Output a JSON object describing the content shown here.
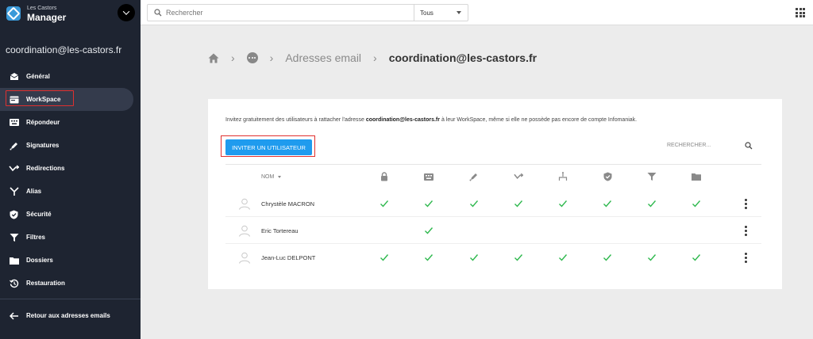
{
  "brand": {
    "small": "Les Castors",
    "name": "Manager"
  },
  "account": "coordination@les-castors.fr",
  "sidebar": {
    "items": [
      {
        "label": "Général",
        "icon": "envelope-open-icon"
      },
      {
        "label": "WorkSpace",
        "icon": "workspace-icon",
        "active": true
      },
      {
        "label": "Répondeur",
        "icon": "keyboard-icon"
      },
      {
        "label": "Signatures",
        "icon": "pen-icon"
      },
      {
        "label": "Redirections",
        "icon": "redirect-icon"
      },
      {
        "label": "Alias",
        "icon": "alias-icon"
      },
      {
        "label": "Sécurité",
        "icon": "shield-icon"
      },
      {
        "label": "Filtres",
        "icon": "filter-icon"
      },
      {
        "label": "Dossiers",
        "icon": "folder-icon"
      },
      {
        "label": "Restauration",
        "icon": "history-icon"
      }
    ],
    "back_label": "Retour aux adresses emails"
  },
  "topbar": {
    "search_placeholder": "Rechercher",
    "scope": "Tous"
  },
  "breadcrumb": {
    "section": "Adresses email",
    "current": "coordination@les-castors.fr"
  },
  "card": {
    "intro_before": "Invitez gratuitement des utilisateurs à rattacher l'adresse ",
    "intro_email": "coordination@les-castors.fr",
    "intro_after": " à leur WorkSpace, même si elle ne possède pas encore de compte Infomaniak.",
    "invite_label": "INVITER UN UTILISATEUR",
    "search_label": "RECHERCHER...",
    "name_header": "NOM",
    "columns": [
      "lock-icon",
      "keyboard-icon",
      "pen-icon",
      "redirect-icon",
      "alias-icon",
      "shield-icon",
      "filter-icon",
      "folder-icon"
    ],
    "users": [
      {
        "name": "Chrystèle MACRON",
        "perms": [
          true,
          true,
          true,
          true,
          true,
          true,
          true,
          true
        ]
      },
      {
        "name": "Eric Tortereau",
        "perms": [
          false,
          true,
          false,
          false,
          false,
          false,
          false,
          false
        ]
      },
      {
        "name": "Jean-Luc DELPONT",
        "perms": [
          true,
          true,
          true,
          true,
          true,
          true,
          true,
          true
        ]
      }
    ]
  },
  "colors": {
    "sidebar": "#1e2431",
    "accent": "#1f9bee",
    "check": "#2db84d",
    "highlight": "#e0302f"
  }
}
